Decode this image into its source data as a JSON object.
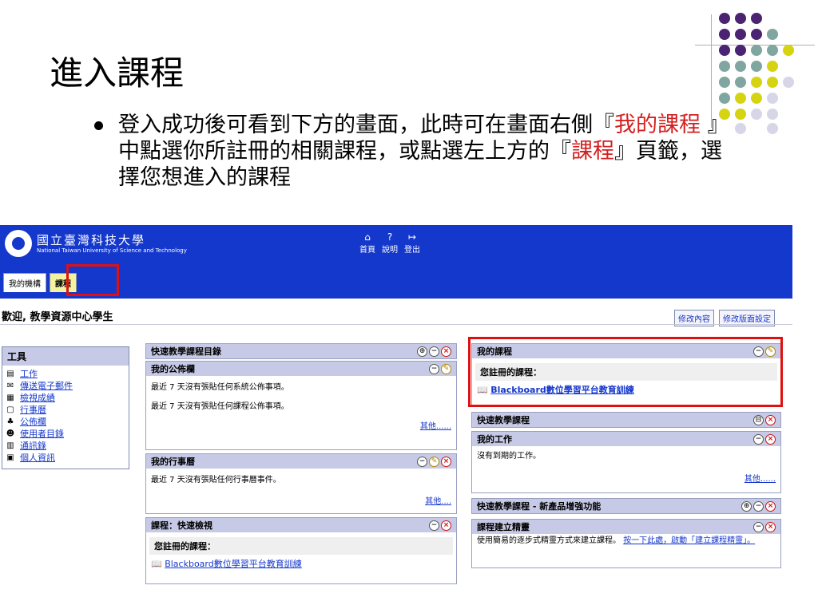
{
  "slide": {
    "title": "進入課程",
    "bullet_part1": "登入成功後可看到下方的畫面，此時可在畫面右側『",
    "bullet_red1": "我的課程",
    "bullet_part2": " 』中點選你所註冊的相關課程，或點選左上方的『",
    "bullet_red2": "課程",
    "bullet_part3": "』頁籤，選擇您想進入的課程"
  },
  "colors": {
    "header_blue": "#1437cc",
    "panel_header": "#c7cae6",
    "highlight_red": "#e01010",
    "accent_red": "#d42020"
  },
  "header": {
    "logo_cn": "國立臺灣科技大學",
    "logo_en": "National Taiwan University of Science and Technology",
    "nav": [
      {
        "icon": "home-icon",
        "glyph": "⌂",
        "label": "首頁"
      },
      {
        "icon": "help-icon",
        "glyph": "?",
        "label": "說明"
      },
      {
        "icon": "logout-icon",
        "glyph": "↦",
        "label": "登出"
      }
    ],
    "tabs": [
      "我的機構",
      "課程"
    ]
  },
  "welcome": "歡迎, 教學資源中心學生",
  "toplinks": [
    "修改內容",
    "修改版面設定"
  ],
  "tools": {
    "title": "工具",
    "items": [
      {
        "icon": "work-icon",
        "label": "工作"
      },
      {
        "icon": "mail-icon",
        "label": "傳送電子郵件"
      },
      {
        "icon": "grades-icon",
        "label": "檢視成績"
      },
      {
        "icon": "calendar-icon",
        "label": "行事曆"
      },
      {
        "icon": "announcement-icon",
        "label": "公佈欄"
      },
      {
        "icon": "user-dir-icon",
        "label": "使用者目錄"
      },
      {
        "icon": "address-book-icon",
        "label": "通訊錄"
      },
      {
        "icon": "personal-info-icon",
        "label": "個人資訊"
      }
    ]
  },
  "panels": {
    "quick_catalog": {
      "title": "快速教學課程目錄"
    },
    "announcements": {
      "title": "我的公佈欄",
      "line1": "最近 7 天沒有張貼任何系統公佈事項。",
      "line2": "最近 7 天沒有張貼任何課程公佈事項。",
      "more": "其他......"
    },
    "calendar": {
      "title": "我的行事曆",
      "line1": "最近 7 天沒有張貼任何行事曆事件。",
      "more": "其他...."
    },
    "course_quickview": {
      "title": "課程：快速檢視",
      "sub": "您註冊的課程：",
      "course": "Blackboard數位學習平台教育訓練"
    },
    "my_courses": {
      "title": "我的課程",
      "sub": "您註冊的課程：",
      "course": "Blackboard數位學習平台教育訓練"
    },
    "quick_course": {
      "title": "快速教學課程"
    },
    "my_tasks": {
      "title": "我的工作",
      "line1": "沒有到期的工作。",
      "more": "其他......"
    },
    "new_features": {
      "title": "快速教學課程 - 新產品增強功能"
    },
    "wizard": {
      "title": "課程建立精靈",
      "text": "使用簡易的逐步式精靈方式來建立課程。",
      "link": "按一下此處，啟動「建立課程精靈」。"
    }
  }
}
